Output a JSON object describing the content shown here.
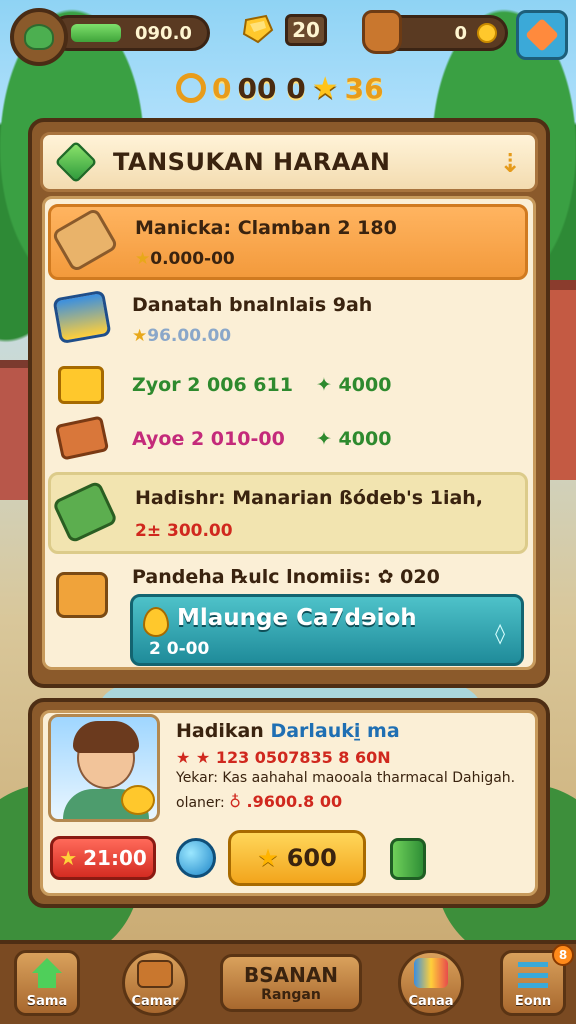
{
  "hud": {
    "xp_value": "090.0",
    "gem_count": "20",
    "coin_value": "0",
    "stats": {
      "ring_value": "0",
      "value": "00 0",
      "star_value": "36"
    }
  },
  "panel": {
    "title": "TANSUKAN HARAAN",
    "rows": [
      {
        "title": "Manicka: Clamban 2 180",
        "sub": "0.000-00",
        "highlight": "orange"
      },
      {
        "title": "Danatah bnalnlais 9ah",
        "sub": "96.00.00"
      },
      {
        "name": "Zyor 2 006 611",
        "value": "4000",
        "name_color": "#2e8a2e"
      },
      {
        "name": "Ayoe 2 010-00",
        "value": "4000",
        "name_color": "#c42a7a"
      },
      {
        "title": "Hadishr: Manarian ßódeb's 1iah,",
        "sub": "2± 300.00",
        "highlight": "yellow"
      },
      {
        "title": "Pandeha ℞ulc lnomiis: ✿ 020"
      }
    ],
    "cta": {
      "label": "Mlaunge Ca7dɘioh",
      "sub": "2 0-00"
    }
  },
  "character": {
    "name_prefix": "Hadikan ",
    "name_highlight": "Darlauki̱ ma",
    "stars_text": "★ ★ 123 0507835 8 60N",
    "desc_text": "Yekar: Kas aahahal maooala tharmacal Dahigah.",
    "status_label": "olaner:",
    "status_value": "♁ .9600.8 00",
    "red_button": "21:00",
    "gold_button": "600"
  },
  "nav": {
    "home": "Sama",
    "camera": "Camar",
    "center_big": "BSANAN",
    "center_small": "Rangan",
    "shop": "Canaa",
    "menu": "Eonn",
    "notif": "8"
  },
  "colors": {
    "panel_wood": "#8b5a2b",
    "parchment": "#fbefd6",
    "accent_orange": "#f39a3c",
    "accent_teal": "#1f8b9a",
    "accent_gold": "#f2a51c"
  }
}
